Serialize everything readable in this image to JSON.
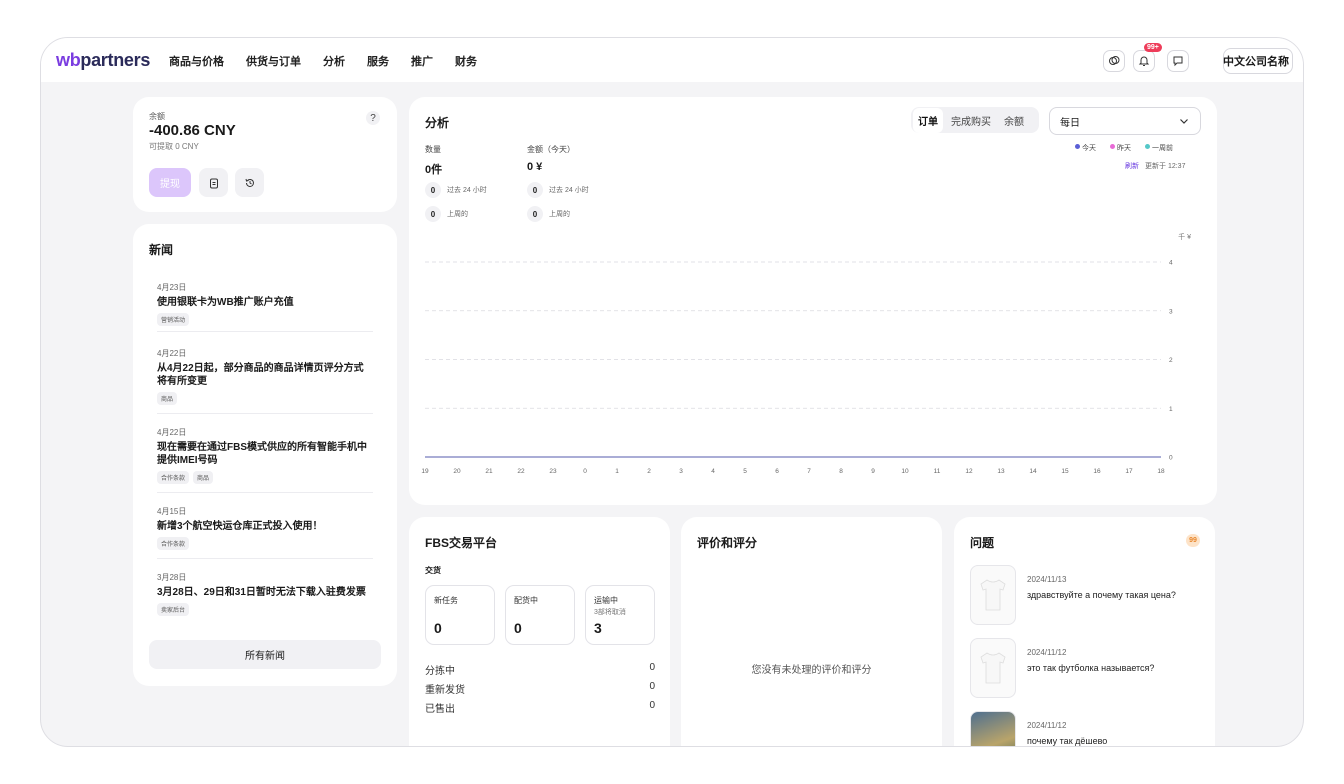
{
  "header": {
    "logo_wb": "wb",
    "logo_rest": "partners",
    "nav": [
      "商品与价格",
      "供货与订单",
      "分析",
      "服务",
      "推广",
      "财务"
    ],
    "notif_badge": "99+",
    "company": "中文公司名称"
  },
  "balance": {
    "label": "余额",
    "amount": "-400.86 CNY",
    "available": "可提取 0 CNY",
    "help": "?",
    "withdraw": "提现"
  },
  "news": {
    "title": "新闻",
    "items": [
      {
        "date": "4月23日",
        "title": "使用银联卡为WB推广账户充值",
        "tags": [
          "营销活动"
        ]
      },
      {
        "date": "4月22日",
        "title": "从4月22日起，部分商品的商品详情页评分方式将有所变更",
        "tags": [
          "商品"
        ]
      },
      {
        "date": "4月22日",
        "title": "现在需要在通过FBS模式供应的所有智能手机中提供IMEI号码",
        "tags": [
          "合作条款",
          "商品"
        ]
      },
      {
        "date": "4月15日",
        "title": "新增3个航空快运仓库正式投入使用！",
        "tags": [
          "合作条款"
        ]
      },
      {
        "date": "3月28日",
        "title": "3月28日、29日和31日暂时无法下载入驻费发票",
        "tags": [
          "卖家后台"
        ]
      }
    ],
    "all_button": "所有新闻"
  },
  "analytics": {
    "title": "分析",
    "tabs": [
      "订单",
      "完成购买",
      "余额"
    ],
    "active_tab": "订单",
    "period": "每日",
    "qty_label": "数量",
    "qty_value": "0件",
    "amount_label": "金额（今天）",
    "amount_value": "0 ¥",
    "last24_value": "0",
    "last24_label": "过去 24 小时",
    "lastweek_value": "0",
    "lastweek_label": "上周的",
    "legend": [
      {
        "label": "今天",
        "color": "#5b5fd6"
      },
      {
        "label": "昨天",
        "color": "#e86bd6"
      },
      {
        "label": "一周前",
        "color": "#55c8c8"
      }
    ],
    "refresh_label": "刷新",
    "updated": "更新于 12:37"
  },
  "chart_data": {
    "type": "line",
    "unit": "千 ¥",
    "x": [
      "19",
      "20",
      "21",
      "22",
      "23",
      "0",
      "1",
      "2",
      "3",
      "4",
      "5",
      "6",
      "7",
      "8",
      "9",
      "10",
      "11",
      "12",
      "13",
      "14",
      "15",
      "16",
      "17",
      "18"
    ],
    "yticks": [
      "0",
      "1",
      "2",
      "3",
      "4"
    ],
    "ylim": [
      0,
      4
    ],
    "grid": true,
    "series": [
      {
        "values": [
          0,
          0,
          0,
          0,
          0,
          0,
          0,
          0,
          0,
          0,
          0,
          0,
          0,
          0,
          0,
          0,
          0,
          0,
          0,
          0,
          0,
          0,
          0,
          0
        ]
      }
    ]
  },
  "fbs": {
    "title": "FBS交易平台",
    "section": "交货",
    "boxes": [
      {
        "label": "新任务",
        "sub": "",
        "value": "0"
      },
      {
        "label": "配货中",
        "sub": "",
        "value": "0"
      },
      {
        "label": "运输中",
        "sub": "3部将取消",
        "value": "3"
      }
    ],
    "rows": [
      {
        "label": "分拣中",
        "value": "0"
      },
      {
        "label": "重新发货",
        "value": "0"
      },
      {
        "label": "已售出",
        "value": "0"
      }
    ]
  },
  "reviews": {
    "title": "评价和评分",
    "empty": "您没有未处理的评价和评分"
  },
  "questions": {
    "title": "问题",
    "badge": "99",
    "items": [
      {
        "date": "2024/11/13",
        "text": "здравствуйте а почему такая цена?"
      },
      {
        "date": "2024/11/12",
        "text": "это так футболка называется?"
      },
      {
        "date": "2024/11/12",
        "text": "почему так дёшево"
      }
    ]
  }
}
